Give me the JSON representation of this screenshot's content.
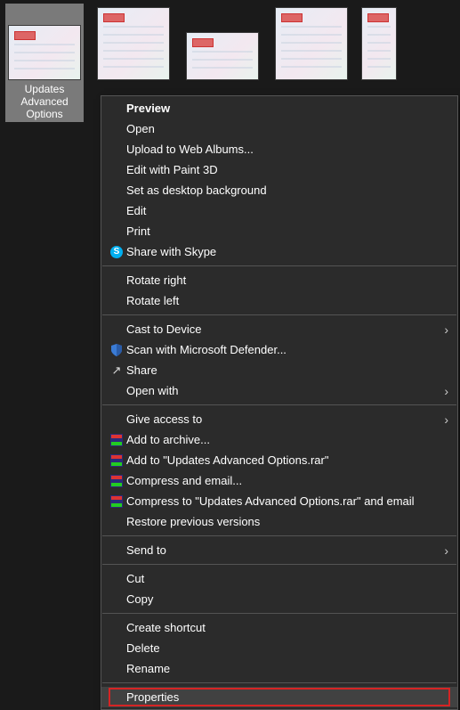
{
  "thumbnails": [
    {
      "label": "Updates Advanced Options",
      "selected": true
    }
  ],
  "menu": {
    "preview": "Preview",
    "open": "Open",
    "upload_web_albums": "Upload to Web Albums...",
    "edit_paint3d": "Edit with Paint 3D",
    "set_desktop_bg": "Set as desktop background",
    "edit": "Edit",
    "print": "Print",
    "share_skype": "Share with Skype",
    "rotate_right": "Rotate right",
    "rotate_left": "Rotate left",
    "cast_to_device": "Cast to Device",
    "scan_defender": "Scan with Microsoft Defender...",
    "share": "Share",
    "open_with": "Open with",
    "give_access_to": "Give access to",
    "add_to_archive": "Add to archive...",
    "add_to_rar": "Add to \"Updates Advanced Options.rar\"",
    "compress_email": "Compress and email...",
    "compress_to_rar_email": "Compress to \"Updates Advanced Options.rar\" and email",
    "restore_previous": "Restore previous versions",
    "send_to": "Send to",
    "cut": "Cut",
    "copy": "Copy",
    "create_shortcut": "Create shortcut",
    "delete": "Delete",
    "rename": "Rename",
    "properties": "Properties"
  }
}
